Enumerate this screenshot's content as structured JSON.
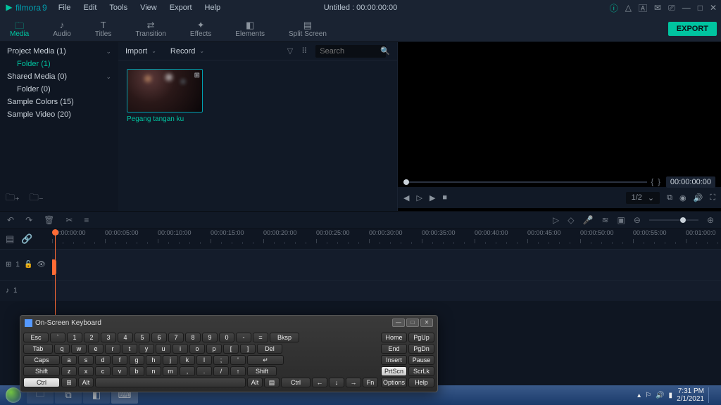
{
  "app": {
    "name": "filmora",
    "version": "9"
  },
  "menus": [
    "File",
    "Edit",
    "Tools",
    "View",
    "Export",
    "Help"
  ],
  "document_title": "Untitled : 00:00:00:00",
  "titlebar_icons": [
    "info",
    "user",
    "notif",
    "mail",
    "cast",
    "min",
    "max",
    "close"
  ],
  "tool_tabs": [
    {
      "label": "Media",
      "active": true
    },
    {
      "label": "Audio",
      "active": false
    },
    {
      "label": "Titles",
      "active": false
    },
    {
      "label": "Transition",
      "active": false
    },
    {
      "label": "Effects",
      "active": false
    },
    {
      "label": "Elements",
      "active": false
    },
    {
      "label": "Split Screen",
      "active": false
    }
  ],
  "export_label": "EXPORT",
  "tree": [
    {
      "label": "Project Media (1)",
      "expand": true
    },
    {
      "label": "Folder (1)",
      "sub": true,
      "active": true
    },
    {
      "label": "Shared Media (0)",
      "expand": true
    },
    {
      "label": "Folder (0)",
      "sub": true,
      "active": false
    },
    {
      "label": "Sample Colors (15)",
      "expand": false
    },
    {
      "label": "Sample Video (20)",
      "expand": false
    }
  ],
  "media_top": {
    "import": "Import",
    "record": "Record",
    "search_placeholder": "Search"
  },
  "media_item": {
    "label": "Pegang tangan ku"
  },
  "preview": {
    "time": "00:00:00:00",
    "ratio": "1/2"
  },
  "timeline": {
    "ticks": [
      "00:00:00:00",
      "00:00:05:00",
      "00:00:10:00",
      "00:00:15:00",
      "00:00:20:00",
      "00:00:25:00",
      "00:00:30:00",
      "00:00:35:00",
      "00:00:40:00",
      "00:00:45:00",
      "00:00:50:00",
      "00:00:55:00",
      "00:01:00:0"
    ],
    "video_track": "1",
    "audio_track": "1"
  },
  "osk": {
    "title": "On-Screen Keyboard",
    "row1": [
      "Esc",
      "`",
      "1",
      "2",
      "3",
      "4",
      "5",
      "6",
      "7",
      "8",
      "9",
      "0",
      "-",
      "=",
      "Bksp"
    ],
    "row1_sup": [
      "",
      "~",
      "!",
      "@",
      "#",
      "$",
      "%",
      "^",
      "&",
      "*",
      "(",
      ")",
      "_",
      "+",
      ""
    ],
    "row2": [
      "Tab",
      "q",
      "w",
      "e",
      "r",
      "t",
      "y",
      "u",
      "i",
      "o",
      "p",
      "[",
      "]",
      "Del"
    ],
    "row3": [
      "Caps",
      "a",
      "s",
      "d",
      "f",
      "g",
      "h",
      "j",
      "k",
      "l",
      ";",
      "'",
      "↵"
    ],
    "row4": [
      "Shift",
      "z",
      "x",
      "c",
      "v",
      "b",
      "n",
      "m",
      ",",
      ".",
      "/",
      "↑",
      "Shift"
    ],
    "row5": [
      "Ctrl",
      "⊞",
      "Alt",
      " ",
      "Alt",
      "▤",
      "Ctrl",
      "←",
      "↓",
      "→",
      "Fn"
    ],
    "side": [
      "Home",
      "PgUp",
      "End",
      "PgDn",
      "Insert",
      "Pause",
      "PrtScn",
      "ScrLk",
      "Options",
      "Help"
    ]
  },
  "taskbar": {
    "time": "7:31 PM",
    "date": "2/1/2021"
  }
}
